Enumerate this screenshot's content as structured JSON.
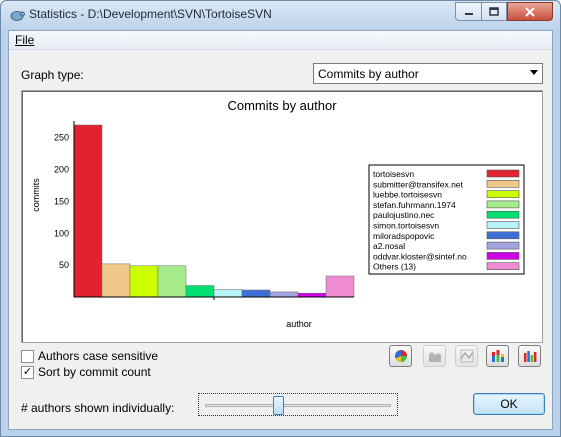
{
  "window": {
    "title": "Statistics - D:\\Development\\SVN\\TortoiseSVN"
  },
  "menu": {
    "file_label": "File"
  },
  "graph_type": {
    "label": "Graph type:",
    "selected": "Commits by author"
  },
  "chart_data": {
    "type": "bar",
    "title": "Commits by author",
    "xlabel": "author",
    "ylabel": "commits",
    "yticks": [
      50,
      100,
      150,
      200,
      250
    ],
    "ylim": [
      0,
      270
    ],
    "categories": [
      "tortoisesvn",
      "submitter@transifex.net",
      "luebbe.tortoisesvn",
      "stefan.fuhrmann.1974",
      "paulojustino.nec",
      "simon.tortoisesvn",
      "miloradspopovic",
      "a2.nosal",
      "oddvar.kloster@sintef.no",
      "Others (13)"
    ],
    "values": [
      270,
      52,
      49,
      49,
      18,
      12,
      11,
      8,
      6,
      33
    ],
    "colors": [
      "#e0232e",
      "#f0c88a",
      "#ccff00",
      "#a6ec8c",
      "#00e070",
      "#b7f3f7",
      "#3f6fd6",
      "#a3a3df",
      "#d000e8",
      "#f08cd2"
    ],
    "legend_placement": "right"
  },
  "options": {
    "case_sensitive_label": "Authors case sensitive",
    "case_sensitive_checked": false,
    "sort_label": "Sort by commit count",
    "sort_checked": true
  },
  "slider": {
    "label": "# authors shown individually:",
    "value_fraction": 0.39
  },
  "ok_label": "OK",
  "toolbar_icons": [
    "pie-chart-icon",
    "area-chart-icon",
    "line-chart-icon",
    "stacked-bar-icon",
    "bar-chart-icon"
  ]
}
